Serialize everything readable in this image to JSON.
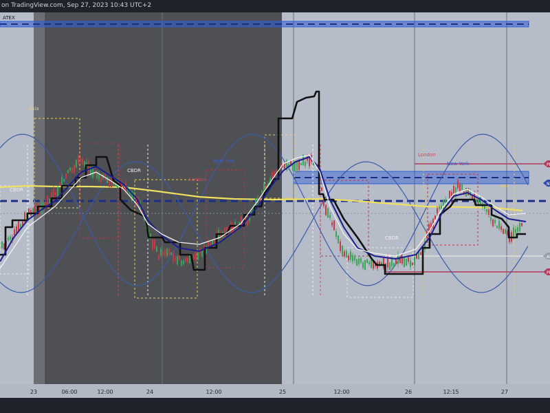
{
  "header": {
    "text": "on TradingView.com, Sep 27, 2023 10:43 UTC+2"
  },
  "chart_data": {
    "type": "line",
    "title": "",
    "x_tick_labels": [
      "23",
      "06:00",
      "12:00",
      "24",
      "12:00",
      "25",
      "12:00",
      "26",
      "12:15",
      "27"
    ],
    "labels": {
      "symbol_fragment": "ATEX",
      "session_asia": "Asia",
      "session_cbdr_1": "CBDR",
      "session_cbdr_2": "CBDR",
      "session_cbdr_3": "CBDR",
      "session_london_1": "London",
      "session_london_2": "London",
      "session_newyork_1": "New York",
      "session_newyork_2": "New York",
      "right_tag_1": "PD",
      "right_tag_2": "NW",
      "right_tag_3": "AL",
      "right_tag_4": "PD",
      "asia_small": "Asia"
    },
    "colors": {
      "background_light": "#b7bcc9",
      "shade_dark": "#4f5054",
      "shade_mid": "#6c6e74",
      "blue_zone": "#2f5fd6",
      "yellow_line": "#f0e060",
      "black_line": "#111111",
      "navy_line": "#1a1f8c",
      "wave_line": "#3b5aa8",
      "white_line": "#f4f4f4",
      "candle_up": "#3aa356",
      "candle_down": "#c53b45",
      "pd_line": "#b23a5a",
      "session_red": "#b3364a",
      "session_blue": "#2c4aa8",
      "asia_yellow": "#e8d25a"
    }
  }
}
